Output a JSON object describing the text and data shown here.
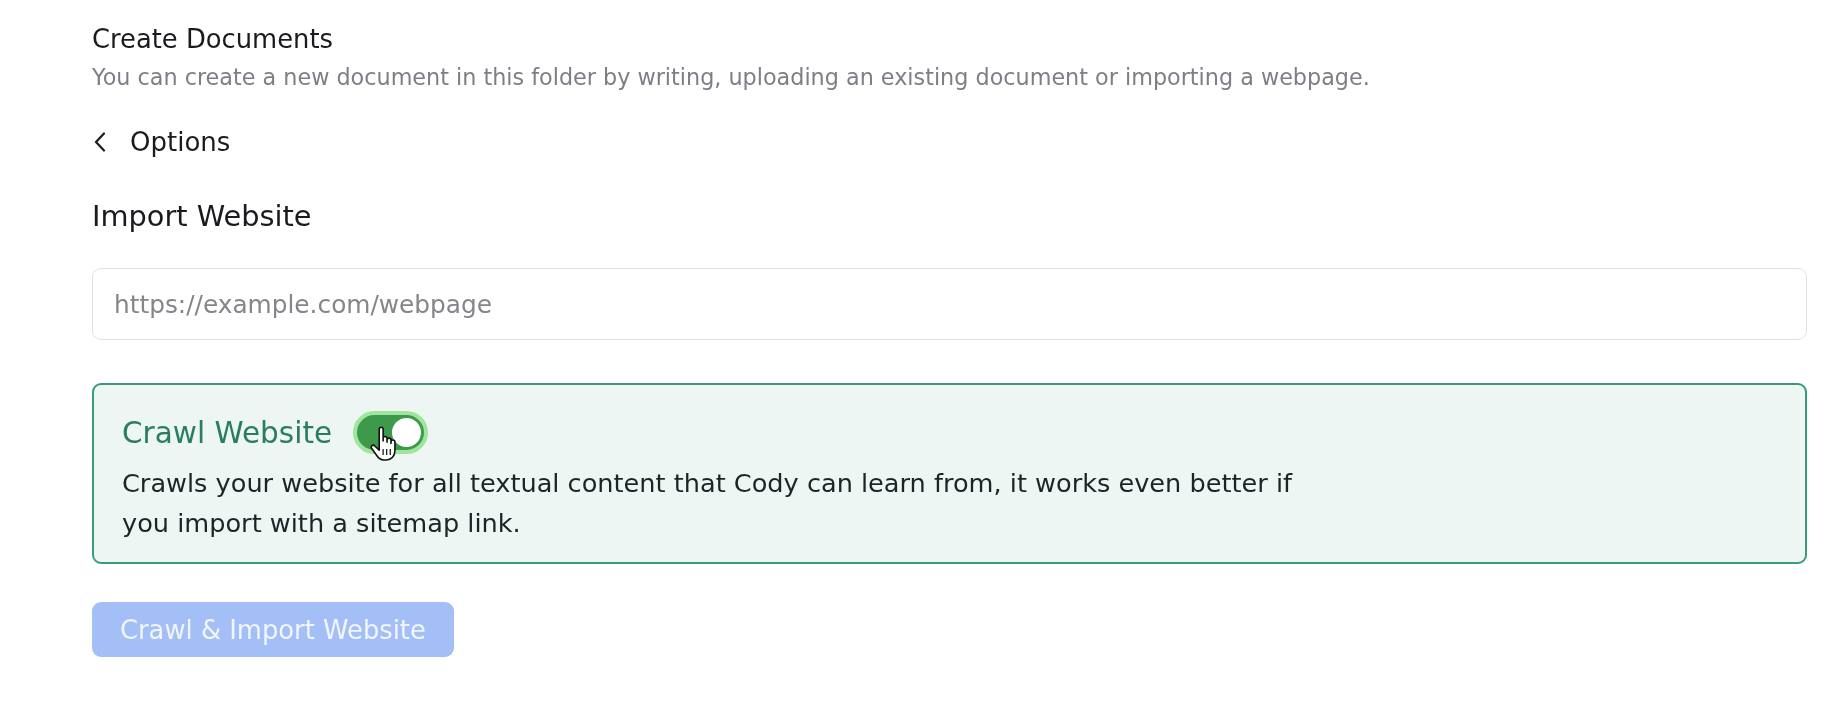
{
  "header": {
    "title": "Create Documents",
    "subtitle": "You can create a new document in this folder by writing, uploading an existing document or importing a webpage."
  },
  "back_link": {
    "label": "Options"
  },
  "section": {
    "title": "Import Website"
  },
  "url_field": {
    "placeholder": "https://example.com/webpage"
  },
  "crawl_option": {
    "title": "Crawl Website",
    "on": true,
    "description": "Crawls your website for all textual content that Cody can learn from, it works even better if you import with a sitemap link."
  },
  "submit_button": {
    "label": "Crawl & Import Website",
    "disabled": true
  }
}
